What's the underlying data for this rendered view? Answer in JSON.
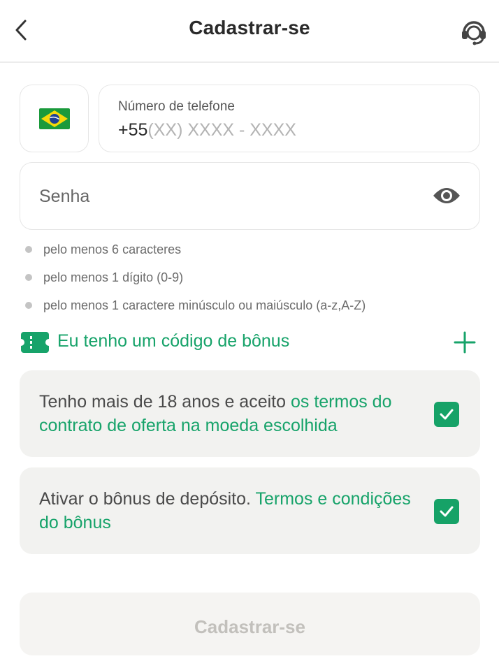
{
  "header": {
    "title": "Cadastrar-se"
  },
  "phone": {
    "label": "Número de telefone",
    "prefix": "+55",
    "placeholder": "(XX) XXXX - XXXX",
    "country_flag": "brazil-flag-icon"
  },
  "password": {
    "placeholder": "Senha"
  },
  "password_rules": [
    "pelo menos 6 caracteres",
    "pelo menos 1 dígito (0-9)",
    "pelo menos 1 caractere minúsculo ou maiúsculo (a-z,A-Z)"
  ],
  "bonus_code": {
    "label": "Eu tenho um código de bônus"
  },
  "terms": {
    "text": "Tenho mais de 18 anos e aceito ",
    "link": "os termos do contrato de oferta na moeda escolhida",
    "checked": true
  },
  "deposit_bonus": {
    "text": "Ativar o bônus de depósito. ",
    "link": "Termos e condições do bônus",
    "checked": true
  },
  "submit_label": "Cadastrar-se",
  "colors": {
    "accent": "#17a36a",
    "checkbox": "#16a267",
    "card_bg": "#f2f2f0",
    "disabled_text": "#c2c0bc"
  }
}
